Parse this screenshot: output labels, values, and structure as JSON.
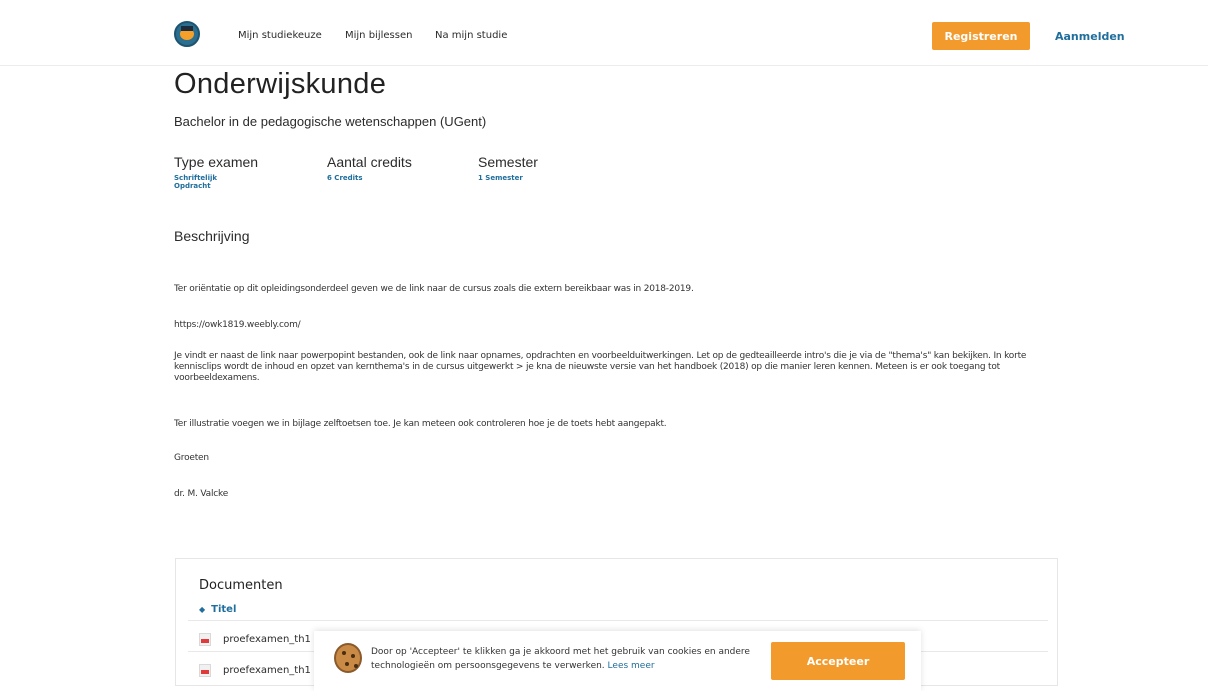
{
  "header": {
    "logo_icon": "graduation-cap-logo-icon",
    "nav": [
      "Mijn studiekeuze",
      "Mijn bijlessen",
      "Na mijn studie"
    ],
    "register_label": "Registreren",
    "login_label": "Aanmelden",
    "accent_color": "#f39a2c",
    "link_color": "#1f6e9c"
  },
  "course": {
    "title": "Onderwijskunde",
    "subtitle": "Bachelor in de pedagogische wetenschappen (UGent)",
    "meta": {
      "exam_type_label": "Type examen",
      "exam_type_values": [
        "Schriftelijk",
        "Opdracht"
      ],
      "credits_label": "Aantal credits",
      "credits_value": "6 Credits",
      "semester_label": "Semester",
      "semester_value": "1 Semester"
    },
    "description_heading": "Beschrijving",
    "paragraphs": [
      "Ter oriëntatie op dit opleidingsonderdeel geven we de link naar de cursus zoals die extern bereikbaar was in 2018-2019.",
      "https://owk1819.weebly.com/",
      "Je vindt er naast de link naar powerpopint bestanden, ook de link naar opnames, opdrachten en voorbeelduitwerkingen. Let op de gedteailleerde intro's die je via de \"thema's\" kan bekijken. In korte kennisclips wordt de inhoud en opzet van kernthema's in de cursus uitgewerkt > je kna de nieuwste versie van het handboek (2018) op die manier leren kennen. Meteen is er ook toegang tot voorbeeldexamens.",
      "Ter illustratie voegen we in bijlage zelftoetsen toe. Je kan meteen ook controleren hoe je de toets hebt aangepakt.",
      "Groeten",
      "dr. M. Valcke"
    ]
  },
  "documents": {
    "heading": "Documenten",
    "column_title": "Titel",
    "rows": [
      "proefexamen_th1",
      "proefexamen_th1"
    ]
  },
  "cookie_banner": {
    "text": "Door op 'Accepteer' te klikken ga je akkoord met het gebruik van cookies en andere technologieën om persoonsgegevens te verwerken.",
    "link": "Lees meer",
    "accept_label": "Accepteer"
  }
}
